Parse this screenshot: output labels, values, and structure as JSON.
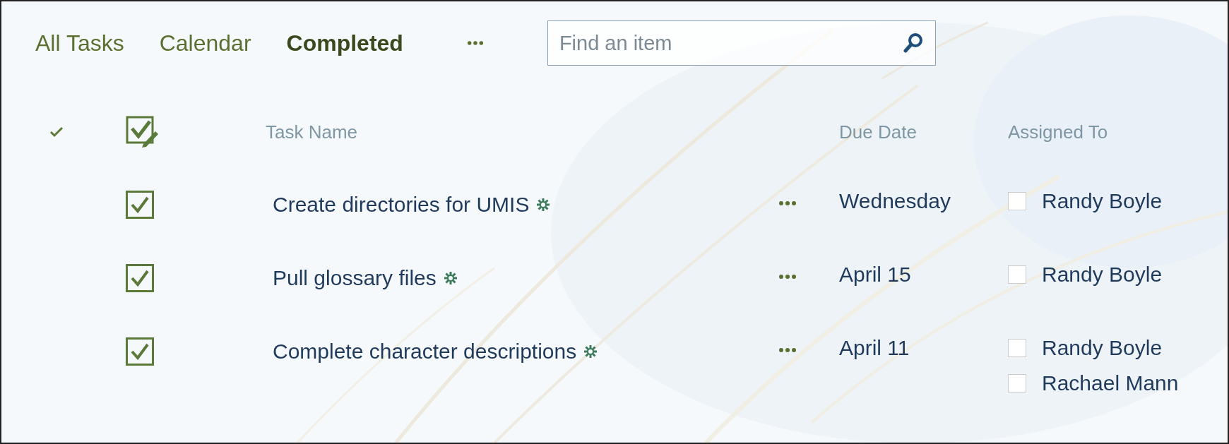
{
  "tabs": [
    {
      "label": "All Tasks",
      "selected": false
    },
    {
      "label": "Calendar",
      "selected": false
    },
    {
      "label": "Completed",
      "selected": true
    }
  ],
  "search": {
    "placeholder": "Find an item"
  },
  "table": {
    "columns": [
      "Task Name",
      "Due Date",
      "Assigned To"
    ],
    "rows": [
      {
        "checked": true,
        "name": "Create directories for UMIS",
        "is_new": true,
        "due": "Wednesday",
        "assigned": [
          "Randy Boyle"
        ]
      },
      {
        "checked": true,
        "name": "Pull glossary files",
        "is_new": true,
        "due": "April 15",
        "assigned": [
          "Randy Boyle"
        ]
      },
      {
        "checked": true,
        "name": "Complete character descriptions",
        "is_new": true,
        "due": "April 11",
        "assigned": [
          "Randy Boyle",
          "Rachael Mann"
        ]
      }
    ]
  }
}
